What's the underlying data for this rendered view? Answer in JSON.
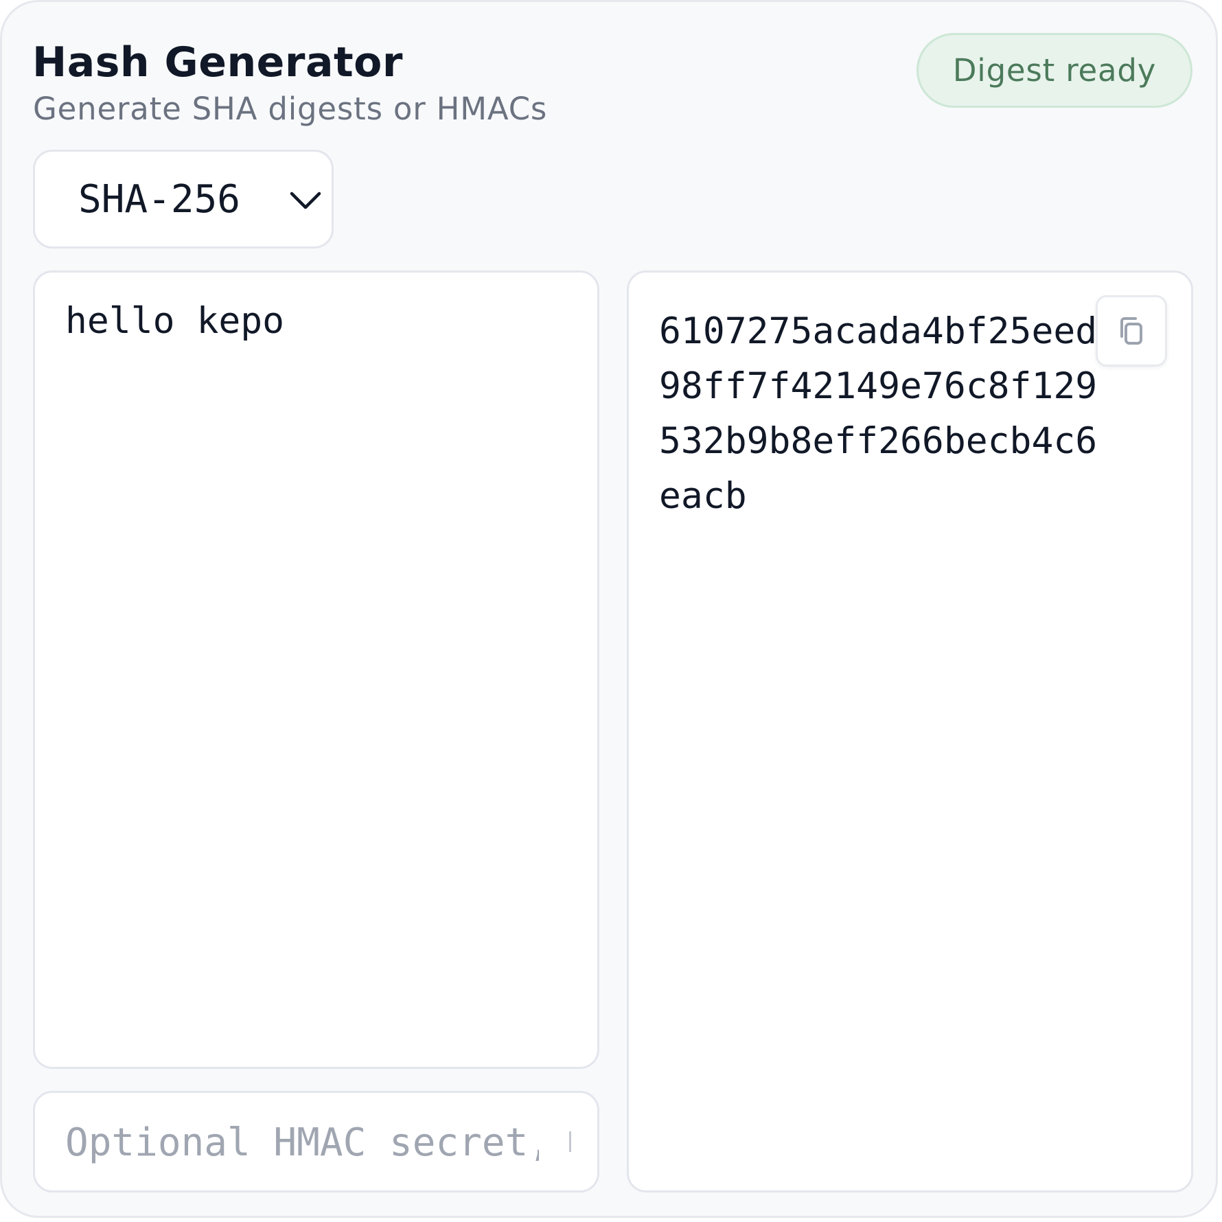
{
  "header": {
    "title": "Hash Generator",
    "subtitle": "Generate SHA digests or HMACs",
    "status_badge": "Digest ready"
  },
  "algorithm_select": {
    "selected": "SHA-256",
    "icon": "chevron-down-icon"
  },
  "input": {
    "value": "hello kepo"
  },
  "secret": {
    "placeholder": "Optional HMAC secret, leave empty for plain digest"
  },
  "output": {
    "digest": "6107275acada4bf25eed98ff7f42149e76c8f129532b9b8eff266becb4c6eacb",
    "copy_icon": "copy-icon"
  },
  "colors": {
    "badge_text": "#4b7a5a",
    "badge_background": "#e8f3ec",
    "card_background": "#f8f9fb",
    "text_primary": "#111827",
    "text_muted": "#6b7280"
  }
}
